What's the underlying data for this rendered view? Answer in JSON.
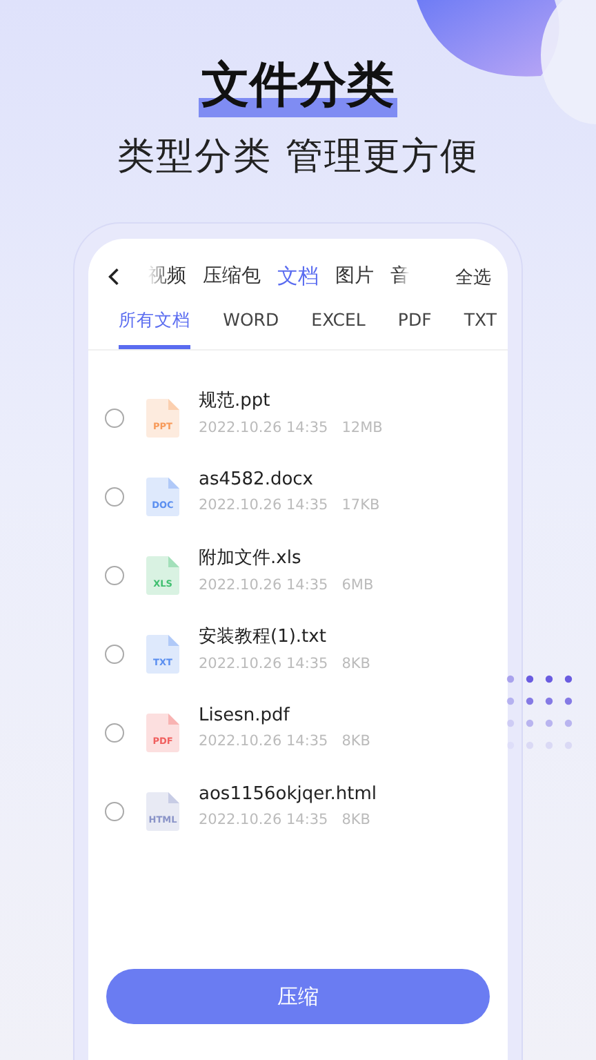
{
  "headline": {
    "title": "文件分类",
    "subtitle": "类型分类 管理更方便"
  },
  "category_tabs": [
    {
      "label": "视频",
      "selected": false
    },
    {
      "label": "压缩包",
      "selected": false
    },
    {
      "label": "文档",
      "selected": true
    },
    {
      "label": "图片",
      "selected": false
    },
    {
      "label": "音",
      "selected": false
    }
  ],
  "select_all": "全选",
  "doc_tabs": [
    {
      "label": "所有文档",
      "selected": true
    },
    {
      "label": "WORD",
      "selected": false
    },
    {
      "label": "EXCEL",
      "selected": false
    },
    {
      "label": "PDF",
      "selected": false
    },
    {
      "label": "TXT",
      "selected": false
    }
  ],
  "files": [
    {
      "name": "规范.ppt",
      "date": "2022.10.26 14:35",
      "size": "12MB",
      "badge": "PPT",
      "color": "#f79a5a",
      "checked": false
    },
    {
      "name": "as4582.docx",
      "date": "2022.10.26 14:35",
      "size": "17KB",
      "badge": "DOC",
      "color": "#5b8ff0",
      "checked": false
    },
    {
      "name": "附加文件.xls",
      "date": "2022.10.26 14:35",
      "size": "6MB",
      "badge": "XLS",
      "color": "#3fbf6f",
      "checked": false
    },
    {
      "name": "安装教程(1).txt",
      "date": "2022.10.26 14:35",
      "size": "8KB",
      "badge": "TXT",
      "color": "#5b8ff0",
      "checked": false
    },
    {
      "name": "Lisesn.pdf",
      "date": "2022.10.26 14:35",
      "size": "8KB",
      "badge": "PDF",
      "color": "#f0605f",
      "checked": false
    },
    {
      "name": "aos1156okjqer.html",
      "date": "2022.10.26 14:35",
      "size": "8KB",
      "badge": "HTML",
      "color": "#8a94c8",
      "checked": false
    }
  ],
  "compress_button": "压缩"
}
